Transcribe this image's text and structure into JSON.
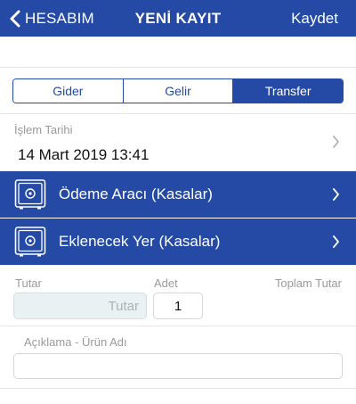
{
  "navbar": {
    "back_label": "HESABIM",
    "title": "YENİ KAYIT",
    "save_label": "Kaydet"
  },
  "segments": [
    {
      "label": "Gider",
      "active": false
    },
    {
      "label": "Gelir",
      "active": false
    },
    {
      "label": "Transfer",
      "active": true
    }
  ],
  "date": {
    "label": "İşlem Tarihi",
    "value": "14 Mart 2019 13:41"
  },
  "payment_source": {
    "label": "Ödeme Aracı (Kasalar)",
    "icon": "safe-icon"
  },
  "destination": {
    "label": "Eklenecek Yer (Kasalar)",
    "icon": "safe-icon"
  },
  "amount": {
    "label": "Tutar",
    "placeholder": "Tutar"
  },
  "quantity": {
    "label": "Adet",
    "value": "1"
  },
  "total": {
    "label": "Toplam Tutar"
  },
  "description": {
    "label": "Açıklama - Ürün Adı"
  },
  "colors": {
    "primary": "#244aa6",
    "amount_field_bg": "#e9f1f3",
    "muted_text": "#9a9a9a"
  }
}
